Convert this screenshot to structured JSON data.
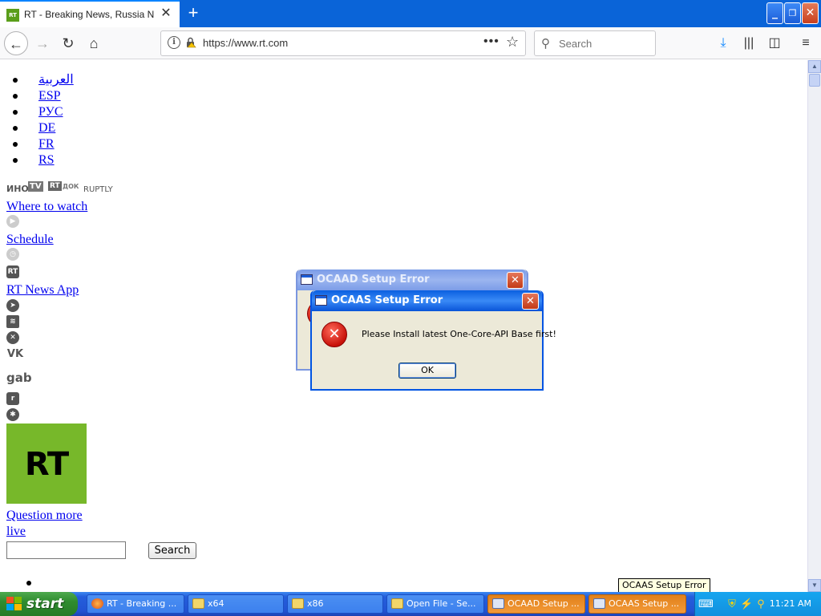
{
  "browser": {
    "tab_title": "RT - Breaking News, Russia News, World News",
    "tab_favicon_text": "RT",
    "url": "https://www.rt.com",
    "search_placeholder": "Search"
  },
  "page": {
    "languages": [
      "العربية",
      "ESP",
      "РУС",
      "DE",
      "FR",
      "RS"
    ],
    "partner_logos": [
      "ИНО",
      "TV",
      "RT",
      "ДОК",
      "RUPTLY"
    ],
    "where_to_watch": "Where to watch",
    "schedule": "Schedule",
    "news_app": "RT News App",
    "gab": "gab",
    "vk": "VK",
    "rt_logo": "RT",
    "question_more": "Question more",
    "live": "live",
    "search_button": "Search"
  },
  "dialogs": {
    "back": {
      "title": "OCAAD Setup Error"
    },
    "front": {
      "title": "OCAAS Setup Error",
      "message": "Please Install latest One-Core-API Base first!",
      "ok_label": "OK"
    }
  },
  "tooltip": "OCAAS Setup Error",
  "taskbar": {
    "start_label": "start",
    "items": [
      {
        "label": "RT - Breaking ...",
        "icon": "firefox-icon",
        "active": false
      },
      {
        "label": "x64",
        "icon": "folder-icon",
        "active": false
      },
      {
        "label": "x86",
        "icon": "folder-icon",
        "active": false
      },
      {
        "label": "Open File - Se...",
        "icon": "folder-icon",
        "active": false
      },
      {
        "label": "OCAAD Setup ...",
        "icon": "setup-icon",
        "active": true
      },
      {
        "label": "OCAAS Setup ...",
        "icon": "setup-icon",
        "active": true
      }
    ],
    "clock": "11:21 AM"
  },
  "colors": {
    "firefox_titlebar": "#0a64d8",
    "rt_green": "#77b82a",
    "xp_taskbar": "#245edb",
    "xp_start_green": "#2f8c2f",
    "error_red": "#c8120a"
  }
}
